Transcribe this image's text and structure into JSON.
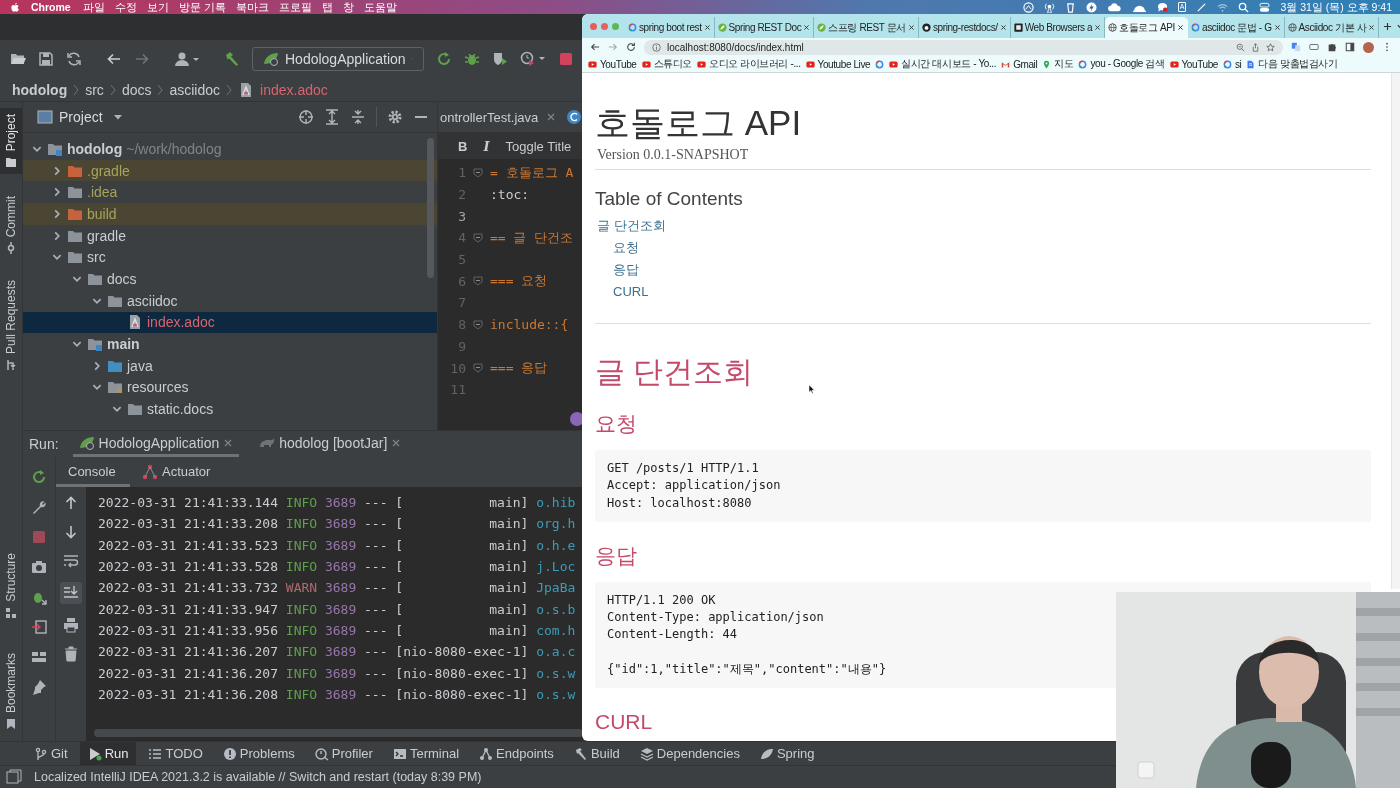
{
  "menu_bar": {
    "app": "Chrome",
    "items": [
      "파일",
      "수정",
      "보기",
      "방문 기록",
      "북마크",
      "프로필",
      "탭",
      "창",
      "도움말"
    ],
    "input_source": "A",
    "clock": "3월 31일 (목) 오후 9:41"
  },
  "ide": {
    "run_config": "HodologApplication",
    "breadcrumb": [
      {
        "label": "hodolog",
        "kind": "project"
      },
      {
        "label": "src",
        "kind": "folder"
      },
      {
        "label": "docs",
        "kind": "folder"
      },
      {
        "label": "asciidoc",
        "kind": "folder"
      },
      {
        "label": "index.adoc",
        "kind": "file"
      }
    ],
    "side_tabs": [
      {
        "label": "Project",
        "selected": true,
        "kind": "folder"
      },
      {
        "label": "Commit",
        "selected": false,
        "kind": "commit"
      },
      {
        "label": "Pull Requests",
        "selected": false,
        "kind": "pull"
      },
      {
        "label": "Structure",
        "selected": false,
        "kind": "structure"
      },
      {
        "label": "Bookmarks",
        "selected": false,
        "kind": "bookmark"
      }
    ],
    "project_panel": {
      "title": "Project",
      "tree": [
        {
          "name": "hodolog",
          "hint": "~/work/hodolog",
          "kind": "module",
          "expanded": true,
          "bold": true,
          "selected": false,
          "children": [
            {
              "name": ".gradle",
              "kind": "folder",
              "expanded": false,
              "excluded": true,
              "ignored": true,
              "selected": false
            },
            {
              "name": ".idea",
              "kind": "folder",
              "expanded": false,
              "ignored": true,
              "selected": false
            },
            {
              "name": "build",
              "kind": "folder",
              "expanded": false,
              "excluded": true,
              "ignored": true,
              "selected": false
            },
            {
              "name": "gradle",
              "kind": "folder",
              "expanded": false,
              "selected": false
            },
            {
              "name": "src",
              "kind": "folder",
              "expanded": true,
              "selected": false,
              "children": [
                {
                  "name": "docs",
                  "kind": "folder",
                  "expanded": true,
                  "selected": false,
                  "children": [
                    {
                      "name": "asciidoc",
                      "kind": "folder",
                      "expanded": true,
                      "selected": false,
                      "children": [
                        {
                          "name": "index.adoc",
                          "kind": "adoc",
                          "untracked": true,
                          "selected": true
                        }
                      ]
                    }
                  ]
                },
                {
                  "name": "main",
                  "kind": "module",
                  "expanded": true,
                  "bold": true,
                  "selected": false,
                  "children": [
                    {
                      "name": "java",
                      "kind": "source",
                      "expanded": false,
                      "selected": false
                    },
                    {
                      "name": "resources",
                      "kind": "resources",
                      "expanded": true,
                      "selected": false,
                      "children": [
                        {
                          "name": "static.docs",
                          "kind": "folder",
                          "expanded": true,
                          "selected": false
                        }
                      ]
                    }
                  ]
                }
              ]
            }
          ]
        }
      ]
    },
    "editor": {
      "tab": "ontrollerTest.java",
      "format_bar": [
        {
          "label": "B",
          "kind": "bold"
        },
        {
          "label": "I",
          "kind": "italic"
        },
        {
          "label": "Toggle Title",
          "kind": "plain"
        }
      ],
      "lines": [
        {
          "number": "1",
          "text": "= 호돌로그 A",
          "kind": "heading",
          "fold": true,
          "current": false
        },
        {
          "number": "2",
          "text": ":toc:",
          "kind": "attribute",
          "current": false
        },
        {
          "number": "3",
          "current": true
        },
        {
          "number": "4",
          "text": "== 글 단건조",
          "kind": "heading",
          "fold": true,
          "current": false
        },
        {
          "number": "5",
          "current": false
        },
        {
          "number": "6",
          "text": "=== 요청",
          "kind": "heading",
          "fold": true,
          "current": false
        },
        {
          "number": "7",
          "current": false
        },
        {
          "number": "8",
          "text": "include::{",
          "kind": "heading",
          "fold": true,
          "current": false
        },
        {
          "number": "9",
          "current": false
        },
        {
          "number": "10",
          "text": "=== 응답",
          "kind": "heading",
          "fold": true,
          "current": false
        },
        {
          "number": "11",
          "current": false
        }
      ]
    },
    "run": {
      "label": "Run:",
      "tabs": [
        {
          "label": "HodologApplication",
          "kind": "spring",
          "selected": true
        },
        {
          "label": "hodolog [bootJar]",
          "kind": "gradle",
          "selected": false
        }
      ],
      "subtabs": [
        {
          "label": "Console",
          "kind": "plain",
          "selected": true
        },
        {
          "label": "Actuator",
          "kind": "actuator",
          "selected": false
        }
      ],
      "log": [
        {
          "timestamp": "2022-03-31 21:41:33.144",
          "level": "INFO",
          "warning": false,
          "pid": "3689",
          "sep": "---",
          "thread": "[           main]",
          "logger": "o.hib"
        },
        {
          "timestamp": "2022-03-31 21:41:33.208",
          "level": "INFO",
          "warning": false,
          "pid": "3689",
          "sep": "---",
          "thread": "[           main]",
          "logger": "org.h"
        },
        {
          "timestamp": "2022-03-31 21:41:33.523",
          "level": "INFO",
          "warning": false,
          "pid": "3689",
          "sep": "---",
          "thread": "[           main]",
          "logger": "o.h.e"
        },
        {
          "timestamp": "2022-03-31 21:41:33.528",
          "level": "INFO",
          "warning": false,
          "pid": "3689",
          "sep": "---",
          "thread": "[           main]",
          "logger": "j.Loc"
        },
        {
          "timestamp": "2022-03-31 21:41:33.732",
          "level": "WARN",
          "warning": true,
          "pid": "3689",
          "sep": "---",
          "thread": "[           main]",
          "logger": "JpaBa"
        },
        {
          "timestamp": "2022-03-31 21:41:33.947",
          "level": "INFO",
          "warning": false,
          "pid": "3689",
          "sep": "---",
          "thread": "[           main]",
          "logger": "o.s.b"
        },
        {
          "timestamp": "2022-03-31 21:41:33.956",
          "level": "INFO",
          "warning": false,
          "pid": "3689",
          "sep": "---",
          "thread": "[           main]",
          "logger": "com.h"
        },
        {
          "timestamp": "2022-03-31 21:41:36.207",
          "level": "INFO",
          "warning": false,
          "pid": "3689",
          "sep": "---",
          "thread": "[nio-8080-exec-1]",
          "logger": "o.a.c"
        },
        {
          "timestamp": "2022-03-31 21:41:36.207",
          "level": "INFO",
          "warning": false,
          "pid": "3689",
          "sep": "---",
          "thread": "[nio-8080-exec-1]",
          "logger": "o.s.w"
        },
        {
          "timestamp": "2022-03-31 21:41:36.208",
          "level": "INFO",
          "warning": false,
          "pid": "3689",
          "sep": "---",
          "thread": "[nio-8080-exec-1]",
          "logger": "o.s.w"
        }
      ]
    },
    "tool_tabs": [
      {
        "label": "Git",
        "kind": "git",
        "selected": false
      },
      {
        "label": "Run",
        "kind": "run",
        "selected": true
      },
      {
        "label": "TODO",
        "kind": "list",
        "selected": false
      },
      {
        "label": "Problems",
        "kind": "problems",
        "selected": false
      },
      {
        "label": "Profiler",
        "kind": "profiler",
        "selected": false
      },
      {
        "label": "Terminal",
        "kind": "terminal",
        "selected": false
      },
      {
        "label": "Endpoints",
        "kind": "endpoints",
        "selected": false
      },
      {
        "label": "Build",
        "kind": "build",
        "selected": false
      },
      {
        "label": "Dependencies",
        "kind": "layers",
        "selected": false
      },
      {
        "label": "Spring",
        "kind": "spring",
        "selected": false
      }
    ],
    "status": "Localized IntelliJ IDEA 2021.3.2 is available // Switch and restart (today 8:39 PM)"
  },
  "browser": {
    "tabs": [
      {
        "title": "spring boot rest",
        "kind": "ring",
        "selected": false
      },
      {
        "title": "Spring REST Doc",
        "kind": "leaf",
        "selected": false
      },
      {
        "title": "스프링 REST 문서",
        "kind": "leaf",
        "selected": false
      },
      {
        "title": "spring-restdocs/",
        "kind": "cat",
        "selected": false
      },
      {
        "title": "Web Browsers a",
        "kind": "square",
        "selected": false
      },
      {
        "title": "호돌로그 API",
        "kind": "globe",
        "selected": true
      },
      {
        "title": "asciidoc 문법 - G",
        "kind": "ring",
        "selected": false
      },
      {
        "title": "Asciidoc 기본 사",
        "kind": "globe",
        "selected": false
      }
    ],
    "url": "localhost:8080/docs/index.html",
    "bookmarks": [
      {
        "label": "YouTube",
        "kind": "play"
      },
      {
        "label": "스튜디오",
        "kind": "play"
      },
      {
        "label": "오디오 라이브러리 -...",
        "kind": "play"
      },
      {
        "label": "Youtube Live",
        "kind": "play"
      },
      {
        "kind": "ring"
      },
      {
        "label": "실시간 대시보드 - Yo...",
        "kind": "play"
      },
      {
        "label": "Gmail",
        "kind": "envelope"
      },
      {
        "label": "지도",
        "kind": "pin"
      },
      {
        "label": "you - Google 검색",
        "kind": "ring"
      },
      {
        "label": "YouTube",
        "kind": "play"
      },
      {
        "label": "si",
        "kind": "ring"
      },
      {
        "label": "다음 맞춤법검사기",
        "kind": "doc"
      }
    ],
    "page": {
      "title": "호돌로그 API",
      "version": "Version 0.0.1-SNAPSHOT",
      "toc_title": "Table of Contents",
      "toc": [
        {
          "label": "글 단건조회",
          "children": [
            {
              "label": "요청"
            },
            {
              "label": "응답"
            },
            {
              "label": "CURL"
            }
          ]
        }
      ],
      "section": "글 단건조회",
      "blocks": [
        {
          "kind": "heading",
          "text": "요청"
        },
        {
          "kind": "code",
          "text": "GET /posts/1 HTTP/1.1\nAccept: application/json\nHost: localhost:8080"
        },
        {
          "kind": "heading",
          "text": "응답"
        },
        {
          "kind": "code",
          "text": "HTTP/1.1 200 OK\nContent-Type: application/json\nContent-Length: 44\n\n{\"id\":1,\"title\":\"제목\",\"content\":\"내용\"}"
        },
        {
          "kind": "heading",
          "text": "CURL"
        }
      ]
    }
  }
}
